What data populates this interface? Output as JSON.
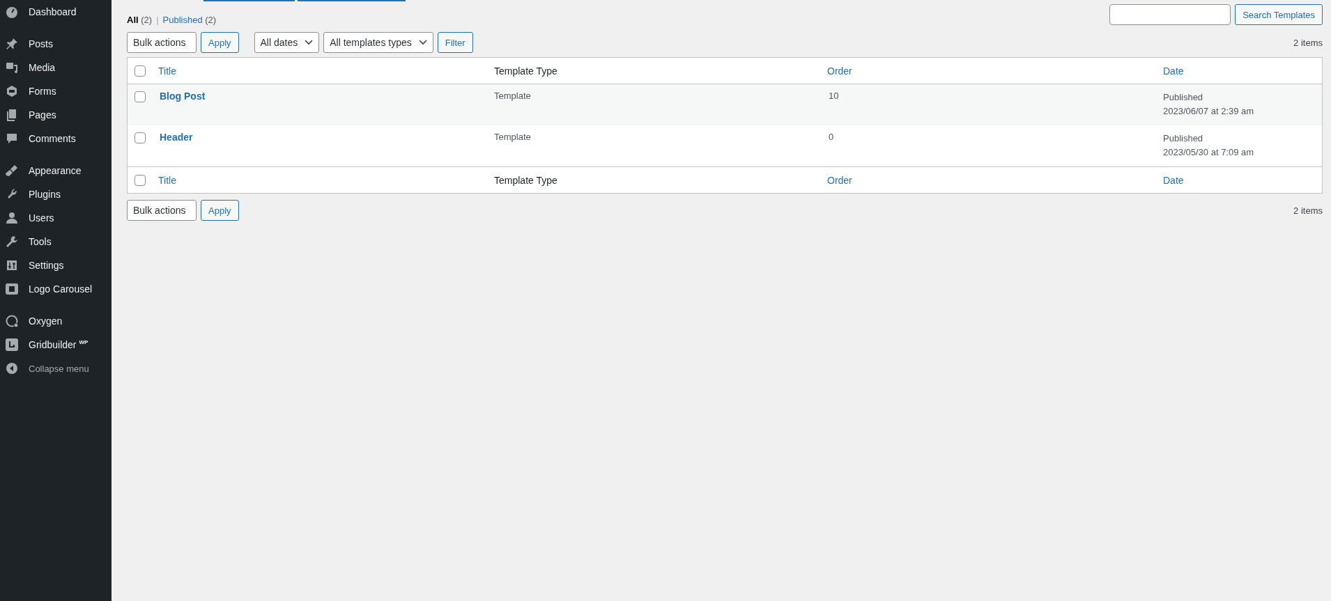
{
  "sidebar": {
    "groups": [
      [
        {
          "label": "Dashboard"
        }
      ],
      [
        {
          "label": "Posts"
        },
        {
          "label": "Media"
        },
        {
          "label": "Forms"
        },
        {
          "label": "Pages"
        },
        {
          "label": "Comments"
        }
      ],
      [
        {
          "label": "Appearance"
        },
        {
          "label": "Plugins"
        },
        {
          "label": "Users"
        },
        {
          "label": "Tools"
        },
        {
          "label": "Settings"
        },
        {
          "label": "Logo Carousel"
        }
      ],
      [
        {
          "label": "Oxygen"
        },
        {
          "label": "Gridbuilder $^{WP}$"
        }
      ]
    ],
    "collapse": {
      "label": "Collapse menu"
    }
  },
  "filter_separator": "|",
  "filters": [
    {
      "label": "All",
      "count": "(2)",
      "selected": true
    },
    {
      "label": "Published",
      "count": "(2)",
      "selected": false
    }
  ],
  "search": {
    "button": "Search Templates"
  },
  "top_toolbar": {
    "bulk_actions": "Bulk actions",
    "apply": "Apply",
    "dates": "All dates",
    "types": "All templates types",
    "filter": "Filter",
    "count": "2 items"
  },
  "table": {
    "columns": [
      "Title",
      "Template Type",
      "Order",
      "Date"
    ],
    "rows": [
      {
        "title": "Blog Post",
        "type": "Template",
        "order": "10",
        "status": "Published",
        "date": "2023/06/07 at 2:39 am",
        "checked": false
      },
      {
        "title": "Header",
        "type": "Template",
        "order": "0",
        "status": "Published",
        "date": "2023/05/30 at 7:09 am",
        "checked": false
      }
    ],
    "footer_columns": [
      "Title",
      "Template Type",
      "Order",
      "Date"
    ],
    "header_checked": false,
    "footer_checked": false
  },
  "bottom_toolbar": {
    "bulk_actions": "Bulk actions",
    "apply": "Apply",
    "count": "2 items"
  }
}
